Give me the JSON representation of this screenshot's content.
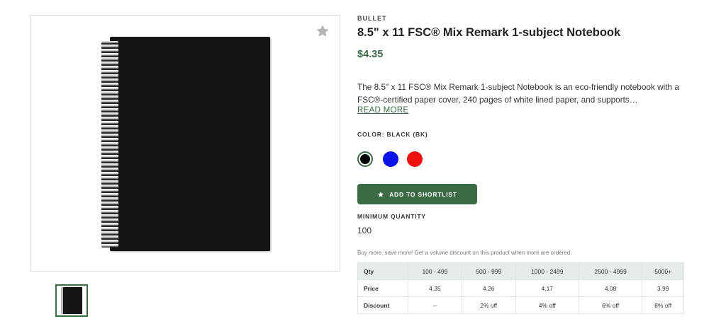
{
  "product": {
    "brand": "BULLET",
    "title": "8.5\" x 11 FSC® Mix Remark 1-subject Notebook",
    "price": "$4.35",
    "description": "The 8.5\" x 11 FSC® Mix Remark 1-subject Notebook is an eco-friendly notebook with a FSC®-certified paper cover, 240 pages of white lined paper, and supports…",
    "read_more": "READ MORE",
    "color_label": "COLOR: BLACK (BK)",
    "colors": [
      {
        "name": "black",
        "hex": "#000000",
        "selected": true
      },
      {
        "name": "blue",
        "hex": "#0a14e6",
        "selected": false
      },
      {
        "name": "red",
        "hex": "#ef1010",
        "selected": false
      }
    ],
    "cta_label": "ADD TO SHORTLIST",
    "min_qty_label": "MINIMUM QUANTITY",
    "min_qty_value": "100",
    "volume_note": "Buy more, save more! Get a volume discount on this product when more are ordered."
  },
  "pricing_table": {
    "header": [
      "Qty",
      "100 - 499",
      "500 - 999",
      "1000 - 2499",
      "2500 - 4999",
      "5000+"
    ],
    "rows": [
      [
        "Price",
        "4.35",
        "4.26",
        "4.17",
        "4.08",
        "3.99"
      ],
      [
        "Discount",
        "--",
        "2% off",
        "4% off",
        "6% off",
        "8% off"
      ]
    ]
  },
  "gallery": {
    "favorite_icon": "star-icon",
    "thumbnail_count": 1
  },
  "theme": {
    "accent": "#3b6b44",
    "table_header_bg": "#e6ecea"
  }
}
